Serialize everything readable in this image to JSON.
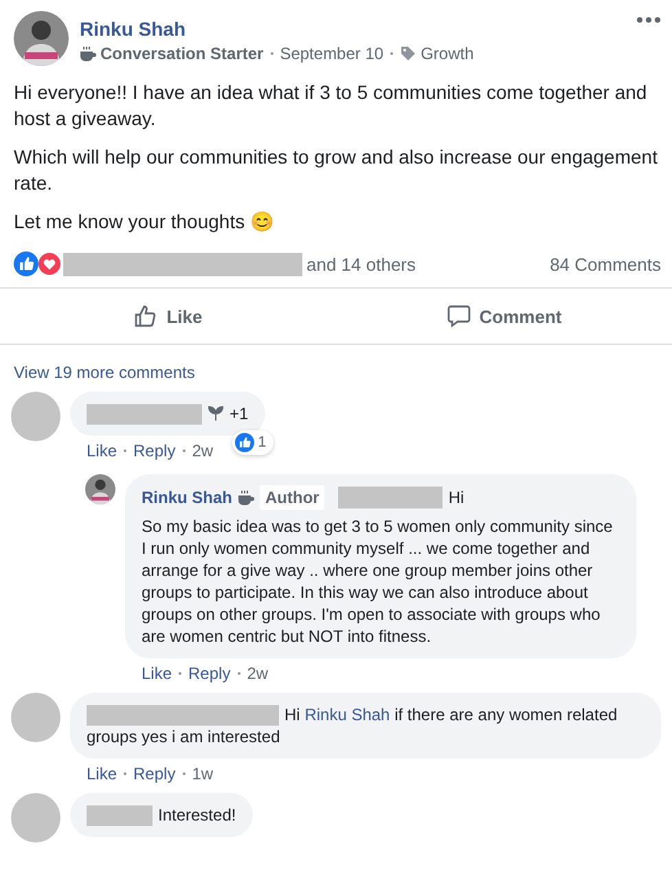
{
  "post": {
    "author": "Rinku Shah",
    "badge": "Conversation Starter",
    "date": "September 10",
    "topic": "Growth",
    "paragraphs": [
      "Hi everyone!! I have an idea what if 3 to 5 communities come together and host a giveaway.",
      "Which will help our communities to grow and also increase our engagement rate.",
      "Let me know your thoughts 😊"
    ],
    "others": "and 14 others",
    "comments_count": "84 Comments"
  },
  "actions": [
    "Like",
    "Comment"
  ],
  "view_more": "View 19 more comments",
  "comments": [
    {
      "kind": "plain",
      "badge_icon": true,
      "text": "+1",
      "reaction_count": "1",
      "actions": [
        "Like",
        "Reply",
        "2w"
      ],
      "replies": [
        {
          "author": "Rinku Shah",
          "badge": "Author",
          "lead": "Hi",
          "body": "So my basic idea was to get 3 to 5 women only community since I run only women community myself ... we come together and arrange for a give way .. where one group member joins other groups to participate. In this way we can also introduce about groups on other groups. I'm open to associate with groups who are women centric but NOT into fitness.",
          "actions": [
            "Like",
            "Reply",
            "2w"
          ]
        }
      ]
    },
    {
      "kind": "mention",
      "lead": "Hi",
      "mention": "Rinku Shah",
      "text": "if there are any women related groups yes i am interested",
      "actions": [
        "Like",
        "Reply",
        "1w"
      ]
    },
    {
      "kind": "plain",
      "badge_icon": false,
      "text": "Interested!"
    }
  ]
}
